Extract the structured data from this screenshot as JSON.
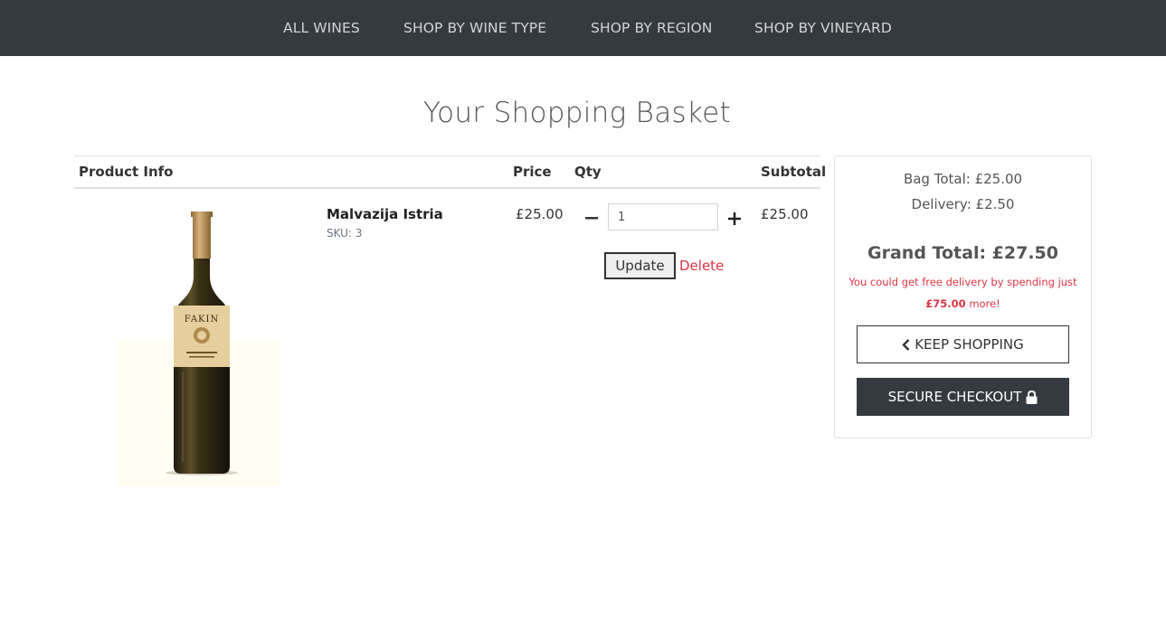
{
  "nav": {
    "items": [
      {
        "label": "ALL WINES"
      },
      {
        "label": "SHOP BY WINE TYPE"
      },
      {
        "label": "SHOP BY REGION"
      },
      {
        "label": "SHOP BY VINEYARD"
      }
    ]
  },
  "page": {
    "title": "Your Shopping Basket"
  },
  "table": {
    "headers": {
      "product": "Product Info",
      "price": "Price",
      "qty": "Qty",
      "subtotal": "Subtotal"
    },
    "items": [
      {
        "name": "Malvazija Istria",
        "sku": "SKU: 3",
        "price": "£25.00",
        "quantity": "1",
        "subtotal": "£25.00",
        "image_alt": "Fakin Malvazija bottle",
        "label_brand": "FAKIN",
        "update_label": "Update",
        "delete_label": "Delete",
        "minus_icon": "minus-icon",
        "plus_icon": "plus-icon"
      }
    ]
  },
  "summary": {
    "bag_total": "Bag Total: £25.00",
    "delivery": "Delivery: £2.50",
    "grand_total": "Grand Total: £27.50",
    "free_delivery_prefix": "You could get free delivery by spending just",
    "free_delivery_amount": "£75.00",
    "free_delivery_suffix": "more!",
    "keep_shopping_label": "KEEP SHOPPING",
    "keep_shopping_icon": "chevron-left-icon",
    "checkout_label": "SECURE CHECKOUT",
    "checkout_icon": "lock-icon"
  },
  "colors": {
    "nav_bg": "#343a40",
    "accent_red": "#dc3545",
    "dark_button": "#343a40"
  }
}
